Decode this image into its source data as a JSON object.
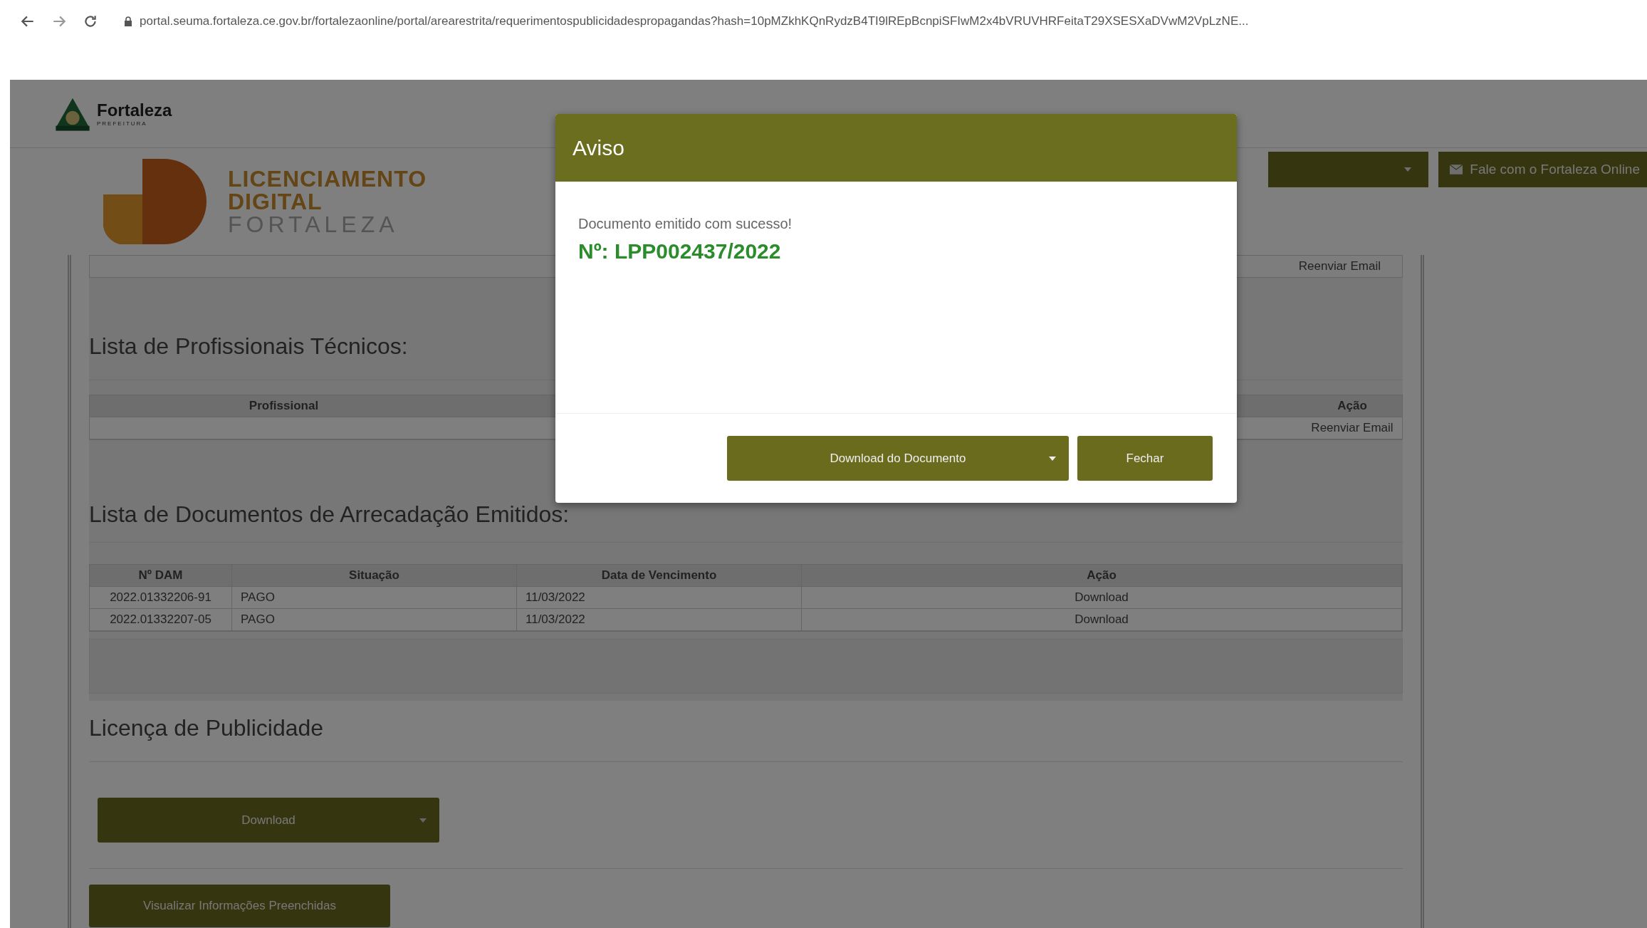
{
  "browser": {
    "url": "portal.seuma.fortaleza.ce.gov.br/fortalezaonline/portal/arearestrita/requerimentospublicidadespropagandas?hash=10pMZkhKQnRydzB4TI9lREpBcnpiSFIwM2x4bVRUVHRFeitaT29XSESXaDVwM2VpLzNE..."
  },
  "header": {
    "city_name": "Fortaleza",
    "city_subtitle": "PREFEITURA",
    "brand_lines": [
      "LICENCIAMENTO",
      "DIGITAL",
      "FORTALEZA"
    ],
    "contact_button": "Fale com o Fortaleza Online"
  },
  "top_row": {
    "action": "Reenviar Email"
  },
  "professionals": {
    "title": "Lista de Profissionais Técnicos:",
    "columns": [
      "Profissional",
      "Ação"
    ],
    "rows": [
      {
        "action": "Reenviar Email"
      }
    ]
  },
  "documents": {
    "title": "Lista de Documentos de Arrecadação Emitidos:",
    "columns": [
      "Nº DAM",
      "Situação",
      "Data de Vencimento",
      "Ação"
    ],
    "rows": [
      [
        "2022.01332206-91",
        "PAGO",
        "11/03/2022",
        "Download"
      ],
      [
        "2022.01332207-05",
        "PAGO",
        "11/03/2022",
        "Download"
      ]
    ]
  },
  "license": {
    "title": "Licença de Publicidade",
    "download_button": "Download",
    "view_button": "Visualizar Informações Preenchidas"
  },
  "modal": {
    "title": "Aviso",
    "message": "Documento emitido com sucesso!",
    "number": "Nº: LPP002437/2022",
    "buttons": [
      {
        "label": "Download do Documento",
        "kind": "dropdown"
      },
      {
        "label": "Fechar",
        "kind": "plain"
      }
    ]
  }
}
